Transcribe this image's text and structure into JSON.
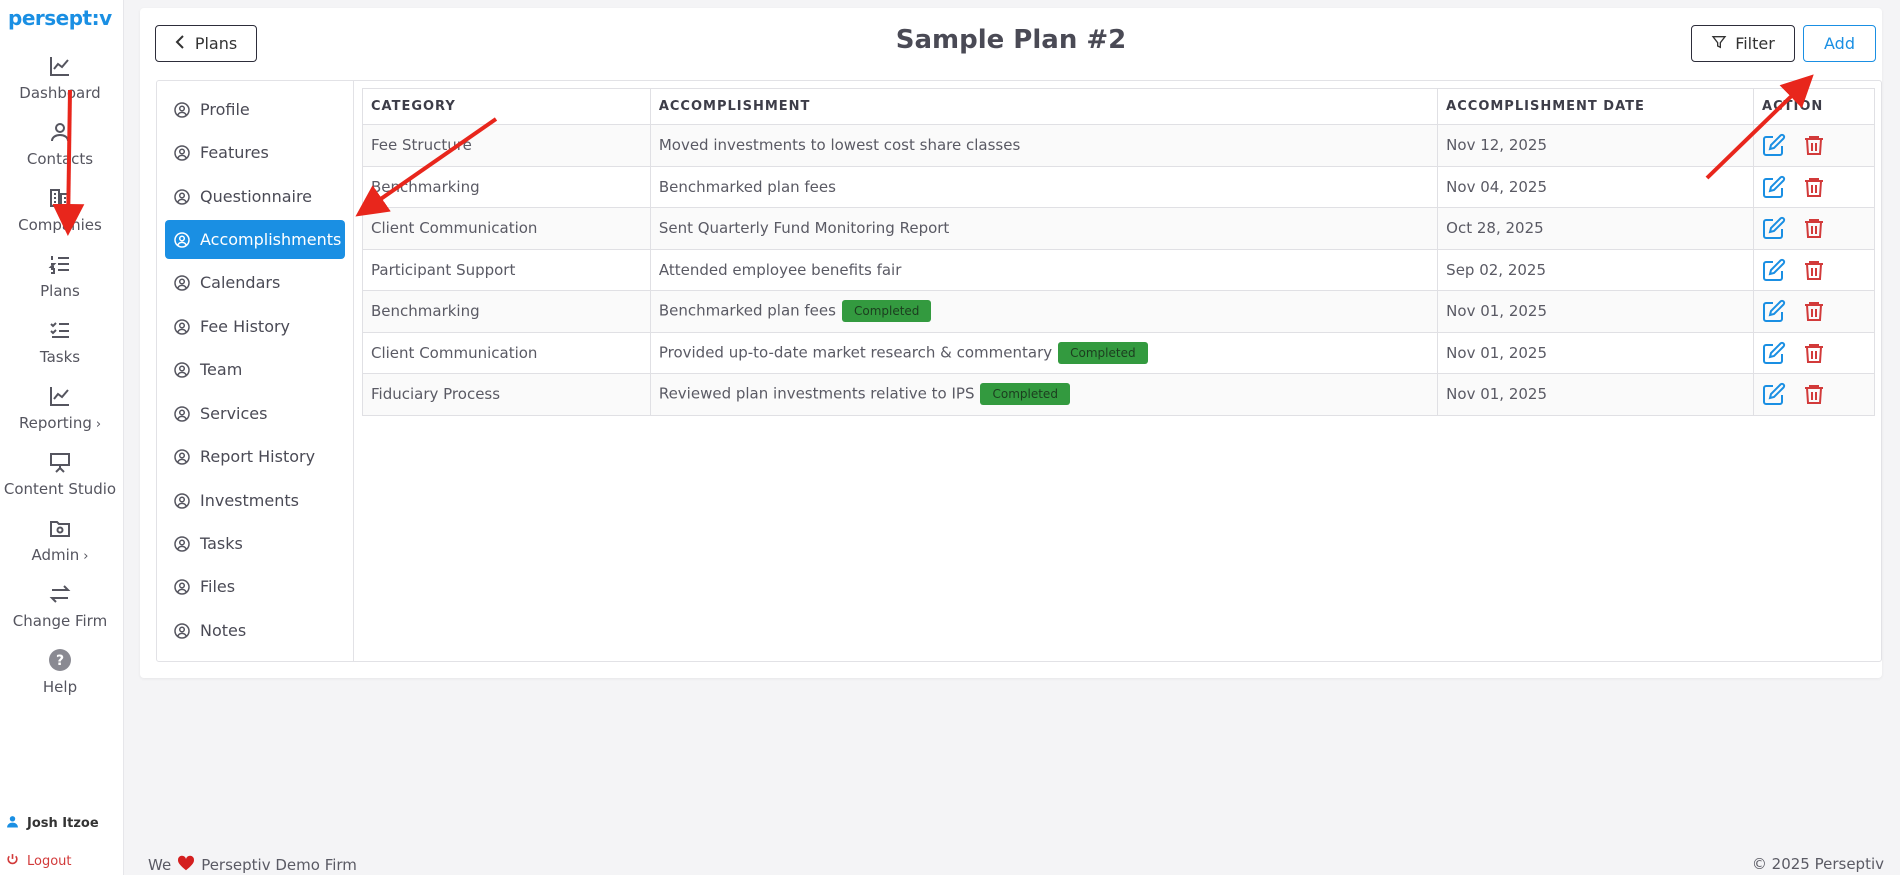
{
  "app": {
    "logo": "persept:v"
  },
  "sidebar": {
    "items": [
      {
        "label": "Dashboard",
        "icon": "chart-line-icon"
      },
      {
        "label": "Contacts",
        "icon": "user-icon"
      },
      {
        "label": "Companies",
        "icon": "building-icon"
      },
      {
        "label": "Plans",
        "icon": "list-ordered-icon"
      },
      {
        "label": "Tasks",
        "icon": "checklist-icon"
      },
      {
        "label": "Reporting",
        "icon": "chart-line-icon",
        "chevron": "›"
      },
      {
        "label": "Content Studio",
        "icon": "presentation-icon"
      },
      {
        "label": "Admin",
        "icon": "folder-gear-icon",
        "chevron": "›"
      },
      {
        "label": "Change Firm",
        "icon": "swap-icon"
      },
      {
        "label": "Help",
        "icon": "help-icon"
      }
    ],
    "user_name": "Josh Itzoe",
    "logout_label": "Logout"
  },
  "header": {
    "back_label": "Plans",
    "title": "Sample Plan #2",
    "filter_label": "Filter",
    "add_label": "Add"
  },
  "subnav": {
    "items": [
      {
        "label": "Profile"
      },
      {
        "label": "Features"
      },
      {
        "label": "Questionnaire"
      },
      {
        "label": "Accomplishments",
        "active": true
      },
      {
        "label": "Calendars"
      },
      {
        "label": "Fee History"
      },
      {
        "label": "Team"
      },
      {
        "label": "Services"
      },
      {
        "label": "Report History"
      },
      {
        "label": "Investments"
      },
      {
        "label": "Tasks"
      },
      {
        "label": "Files"
      },
      {
        "label": "Notes"
      }
    ]
  },
  "table": {
    "columns": [
      "Category",
      "Accomplishment",
      "Accomplishment Date",
      "Action"
    ],
    "rows": [
      {
        "category": "Fee Structure",
        "accomplishment": "Moved investments to lowest cost share classes",
        "badge": "",
        "date": "Nov 12, 2025"
      },
      {
        "category": "Benchmarking",
        "accomplishment": "Benchmarked plan fees",
        "badge": "",
        "date": "Nov 04, 2025"
      },
      {
        "category": "Client Communication",
        "accomplishment": "Sent Quarterly Fund Monitoring Report",
        "badge": "",
        "date": "Oct 28, 2025"
      },
      {
        "category": "Participant Support",
        "accomplishment": "Attended employee benefits fair",
        "badge": "",
        "date": "Sep 02, 2025"
      },
      {
        "category": "Benchmarking",
        "accomplishment": "Benchmarked plan fees",
        "badge": "Completed",
        "date": "Nov 01, 2025"
      },
      {
        "category": "Client Communication",
        "accomplishment": "Provided up-to-date market research & commentary",
        "badge": "Completed",
        "date": "Nov 01, 2025"
      },
      {
        "category": "Fiduciary Process",
        "accomplishment": "Reviewed plan investments relative to IPS",
        "badge": "Completed",
        "date": "Nov 01, 2025"
      }
    ]
  },
  "footer": {
    "left_prefix": "We",
    "left_suffix": "Perseptiv Demo Firm",
    "right": "© 2025 Perseptiv"
  },
  "colors": {
    "accent": "#1a8fe3",
    "danger": "#d23a3a",
    "badge": "#339a3f",
    "annotation": "#e8261c"
  }
}
